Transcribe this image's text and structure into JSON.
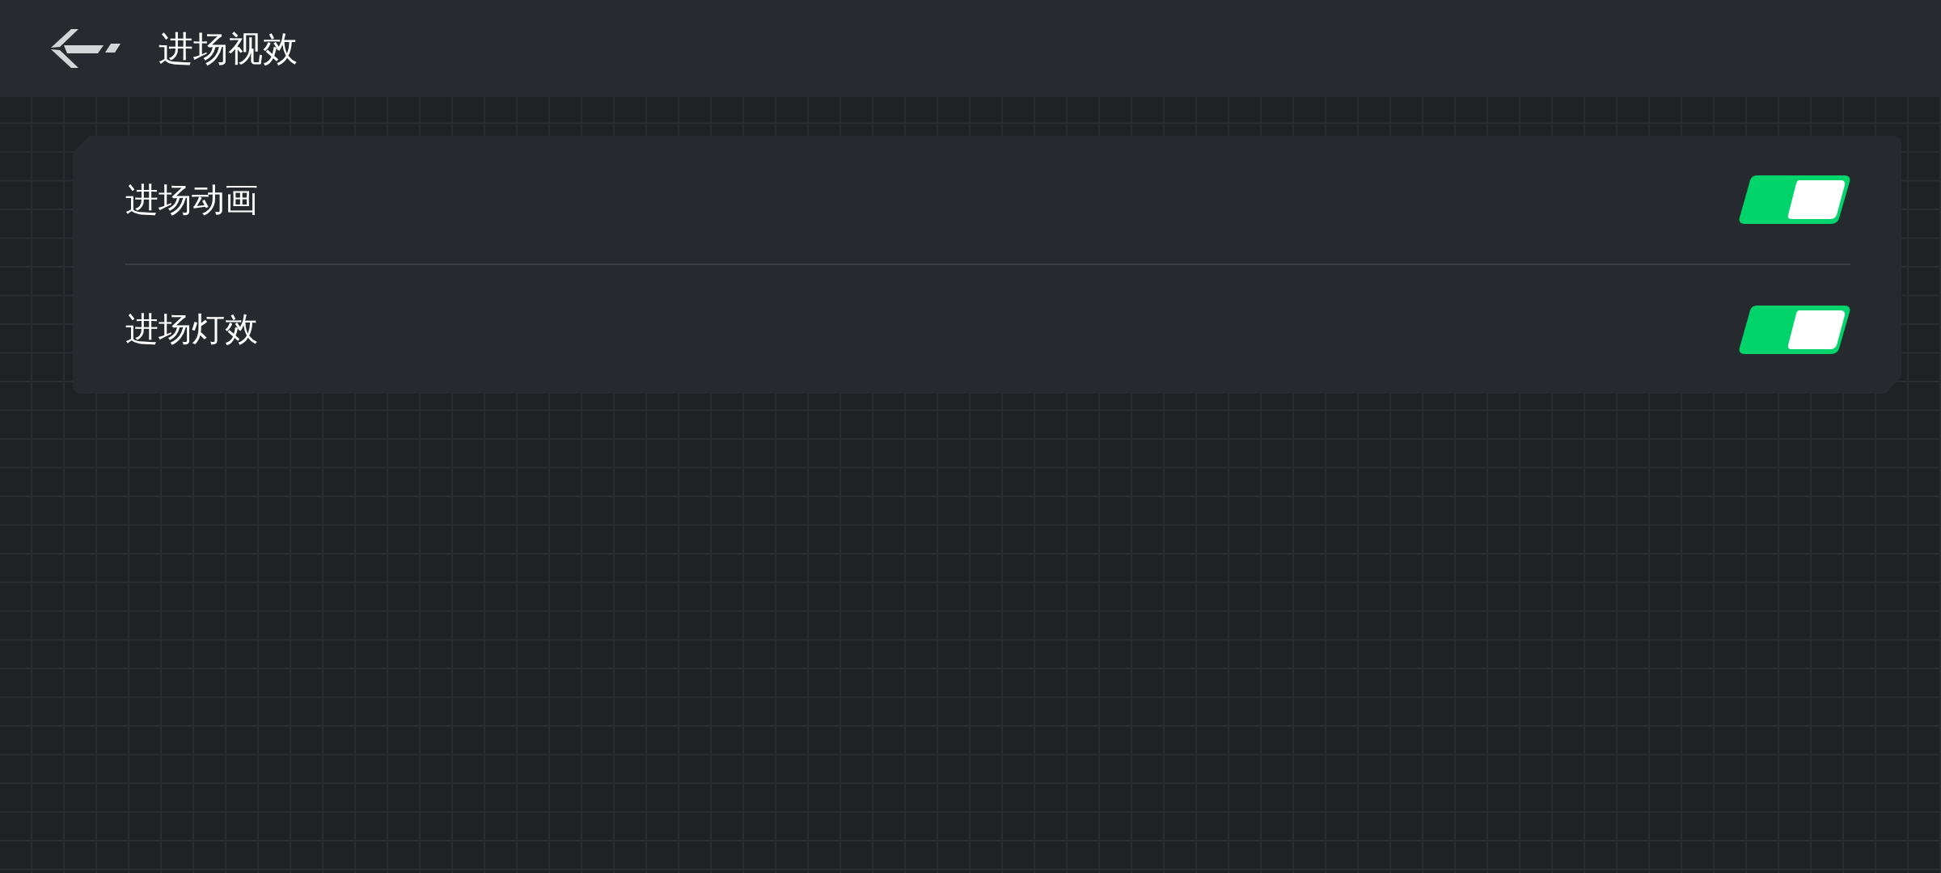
{
  "header": {
    "title": "进场视效"
  },
  "settings": [
    {
      "label": "进场动画",
      "on": true
    },
    {
      "label": "进场灯效",
      "on": true
    }
  ]
}
